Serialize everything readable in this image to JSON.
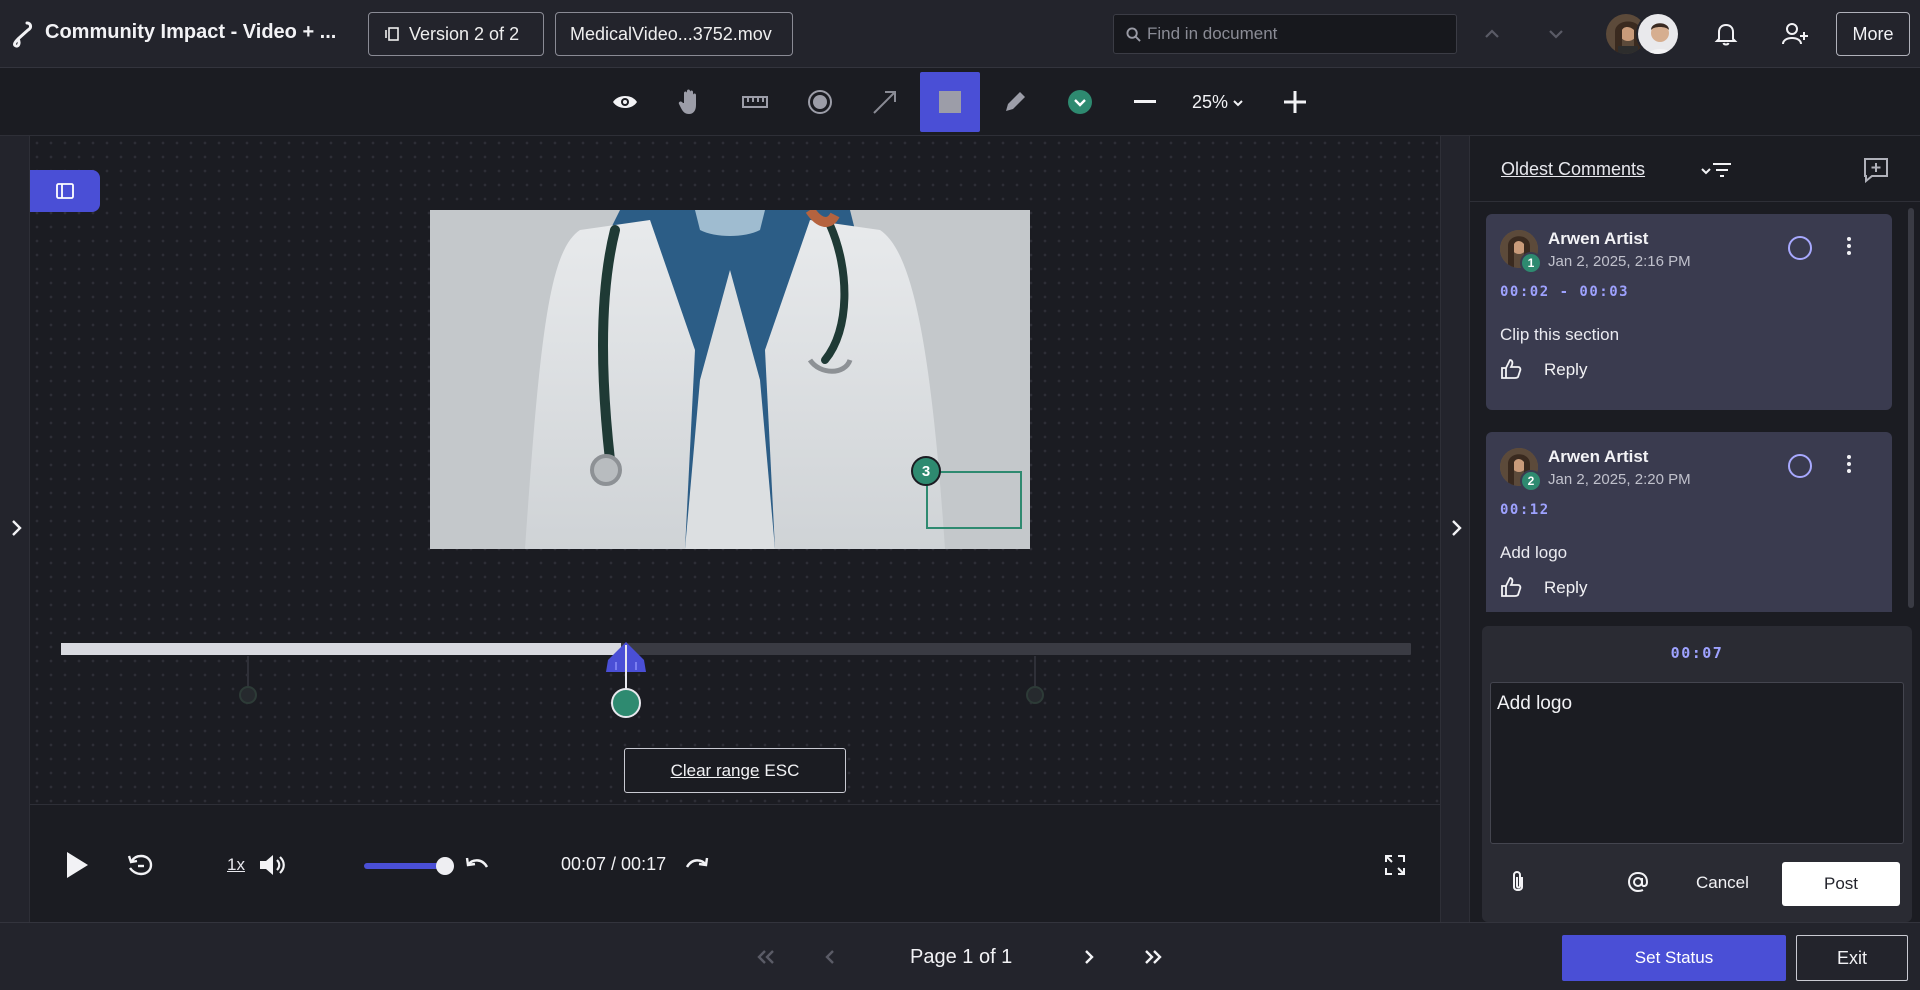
{
  "header": {
    "title": "Community Impact - Video + ...",
    "version_label": "Version 2 of 2",
    "file_label": "MedicalVideo...3752.mov",
    "search_placeholder": "Find in document",
    "more_label": "More"
  },
  "toolbar": {
    "tools": [
      "eye-icon",
      "hand-icon",
      "ruler-icon",
      "record-icon",
      "arrow-icon",
      "rectangle-icon",
      "pencil-icon",
      "color-picker-icon",
      "zoom-out-icon",
      "zoom-in-icon"
    ],
    "active_tool": "rectangle-icon",
    "zoom": "25%"
  },
  "canvas": {
    "annotation_number": "3",
    "clear_range_link": "Clear range",
    "clear_range_key": "ESC"
  },
  "timeline": {
    "progress": 0.415
  },
  "player": {
    "speed": "1x",
    "volume": 0.9,
    "timecode": "00:07 / 00:17"
  },
  "sidebar": {
    "sort_label": "Oldest Comments",
    "comments": [
      {
        "number": "1",
        "author": "Arwen Artist",
        "date": "Jan 2, 2025, 2:16 PM",
        "time": "00:02 - 00:03",
        "text": "Clip this section",
        "reply_label": "Reply"
      },
      {
        "number": "2",
        "author": "Arwen Artist",
        "date": "Jan 2, 2025, 2:20 PM",
        "time": "00:12",
        "text": "Add logo",
        "reply_label": "Reply"
      }
    ],
    "composer": {
      "time": "00:07",
      "text": "Add logo",
      "cancel_label": "Cancel",
      "post_label": "Post"
    }
  },
  "footer": {
    "page_label": "Page 1 of 1",
    "set_status_label": "Set Status",
    "exit_label": "Exit"
  },
  "colors": {
    "accent": "#4a4fd6",
    "marker": "#2e8a70",
    "timecode": "#9ea2ff"
  }
}
